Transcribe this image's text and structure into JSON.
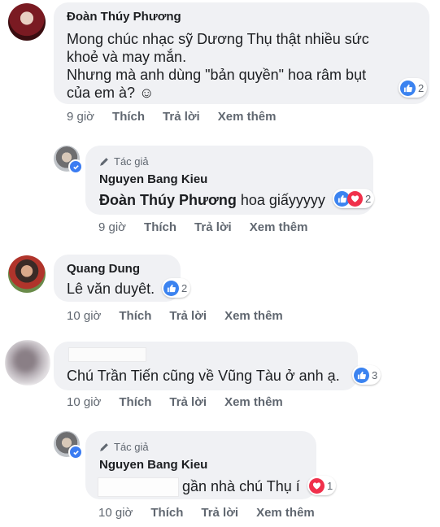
{
  "comments": [
    {
      "author": "Đoàn Thúy Phương",
      "text_lines": [
        "Mong chúc nhạc sỹ Dương Thụ thật nhiều sức",
        "khoẻ và may mắn.",
        "Nhưng mà anh dùng \"bản quyền\" hoa râm bụt",
        "của em à? ☺"
      ],
      "reaction_count": "2",
      "time": "9 giờ",
      "like": "Thích",
      "reply": "Trả lời",
      "more": "Xem thêm"
    },
    {
      "author_tag": "Tác giả",
      "author": "Nguyen Bang Kieu",
      "mention": "Đoàn Thúy Phương",
      "text": "hoa giấyyyyy",
      "reaction_count": "2",
      "time": "9 giờ",
      "like": "Thích",
      "reply": "Trả lời",
      "more": "Xem thêm"
    },
    {
      "author": "Quang Dung",
      "text": "Lê văn duyêt.",
      "reaction_count": "2",
      "time": "10 giờ",
      "like": "Thích",
      "reply": "Trả lời",
      "more": "Xem thêm"
    },
    {
      "text": "Chú Trần Tiến cũng về Vũng Tàu ở anh ạ.",
      "reaction_count": "3",
      "time": "10 giờ",
      "like": "Thích",
      "reply": "Trả lời",
      "more": "Xem thêm"
    },
    {
      "author_tag": "Tác giả",
      "author": "Nguyen Bang Kieu",
      "text": "gần nhà chú Thụ í",
      "reaction_count": "1",
      "time": "10 giờ",
      "like": "Thích",
      "reply": "Trả lời",
      "more": "Xem thêm"
    }
  ],
  "colors": {
    "like": "#3b83f0",
    "love": "#f0304b",
    "bubble": "#f0f1f4",
    "meta": "#606770"
  },
  "icons": [
    "like-icon",
    "love-icon",
    "pen-icon",
    "verified-icon"
  ]
}
